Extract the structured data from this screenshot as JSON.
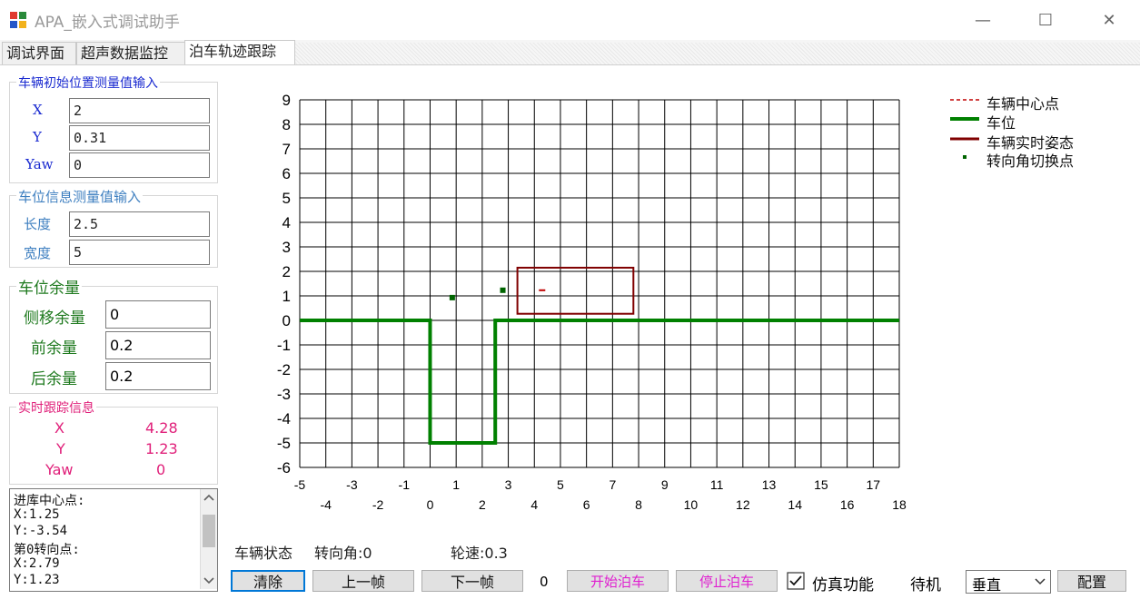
{
  "window": {
    "title": "APA_嵌入式调试助手",
    "minimize": "—",
    "maximize": "☐",
    "close": "✕"
  },
  "tabs": [
    {
      "label": "调试界面"
    },
    {
      "label": "超声数据监控"
    },
    {
      "label": "泊车轨迹跟踪"
    }
  ],
  "init_pos": {
    "title": "车辆初始位置测量值输入",
    "x_label": "X",
    "x_value": "2",
    "y_label": "Y",
    "y_value": "0.31",
    "yaw_label": "Yaw",
    "yaw_value": "0"
  },
  "slot_info": {
    "title": "车位信息测量值输入",
    "length_label": "长度",
    "length_value": "2.5",
    "width_label": "宽度",
    "width_value": "5"
  },
  "margin": {
    "title": "车位余量",
    "side_label": "侧移余量",
    "side_value": "0",
    "front_label": "前余量",
    "front_value": "0.2",
    "rear_label": "后余量",
    "rear_value": "0.2"
  },
  "tracking": {
    "title": "实时跟踪信息",
    "x_label": "X",
    "x_value": "4.28",
    "y_label": "Y",
    "y_value": "1.23",
    "yaw_label": "Yaw",
    "yaw_value": "0"
  },
  "log": [
    "进库中心点:",
    "X:1.25",
    "Y:-3.54",
    "第0转向点:",
    "X:2.79",
    "Y:1.23"
  ],
  "status": {
    "vehicle_state": "车辆状态",
    "steer_angle": "转向角:0",
    "wheel_speed": "轮速:0.3"
  },
  "buttons": {
    "clear": "清除",
    "prev_frame": "上一帧",
    "next_frame": "下一帧",
    "frame_count": "0",
    "start_parking": "开始泊车",
    "stop_parking": "停止泊车",
    "sim_label": "仿真功能",
    "sim_checked": true,
    "state_text": "待机",
    "mode_select": "垂直",
    "config": "配置"
  },
  "legend": [
    {
      "label": "车辆中心点",
      "color": "#c00000",
      "style": "dashed"
    },
    {
      "label": "车位",
      "color": "#008000",
      "style": "solid"
    },
    {
      "label": "车辆实时姿态",
      "color": "#800000",
      "style": "solid"
    },
    {
      "label": "转向角切换点",
      "color": "#006400",
      "style": "marker"
    }
  ],
  "colors": {
    "tracking_text": "#e0207a",
    "section_blue": "#1a2ad0",
    "margin_green": "#1f7a1f",
    "slot_blue": "#3e7fc0"
  },
  "chart_data": {
    "type": "line",
    "xlim": [
      -5,
      18
    ],
    "ylim": [
      -6,
      9
    ],
    "x_ticks_upper": [
      -5,
      -3,
      -1,
      1,
      3,
      5,
      7,
      9,
      11,
      13,
      15,
      17
    ],
    "x_ticks_lower": [
      -4,
      -2,
      0,
      2,
      4,
      6,
      8,
      10,
      12,
      14,
      16,
      18
    ],
    "y_ticks": [
      9,
      8,
      7,
      6,
      5,
      4,
      3,
      2,
      1,
      0,
      -1,
      -2,
      -3,
      -4,
      -5,
      -6
    ],
    "grid": true,
    "series": [
      {
        "name": "车位",
        "points": [
          [
            -5,
            0
          ],
          [
            0,
            0
          ],
          [
            0,
            -5
          ],
          [
            2.5,
            -5
          ],
          [
            2.5,
            0
          ],
          [
            18,
            0
          ]
        ]
      },
      {
        "name": "车辆实时姿态",
        "rect": [
          [
            3.35,
            0.27
          ],
          [
            7.8,
            2.15
          ]
        ]
      },
      {
        "name": "车辆中心点",
        "points": [
          [
            4.28,
            1.23
          ]
        ]
      },
      {
        "name": "转向角切换点",
        "points": [
          [
            0.85,
            0.93
          ],
          [
            2.79,
            1.23
          ]
        ]
      }
    ]
  }
}
